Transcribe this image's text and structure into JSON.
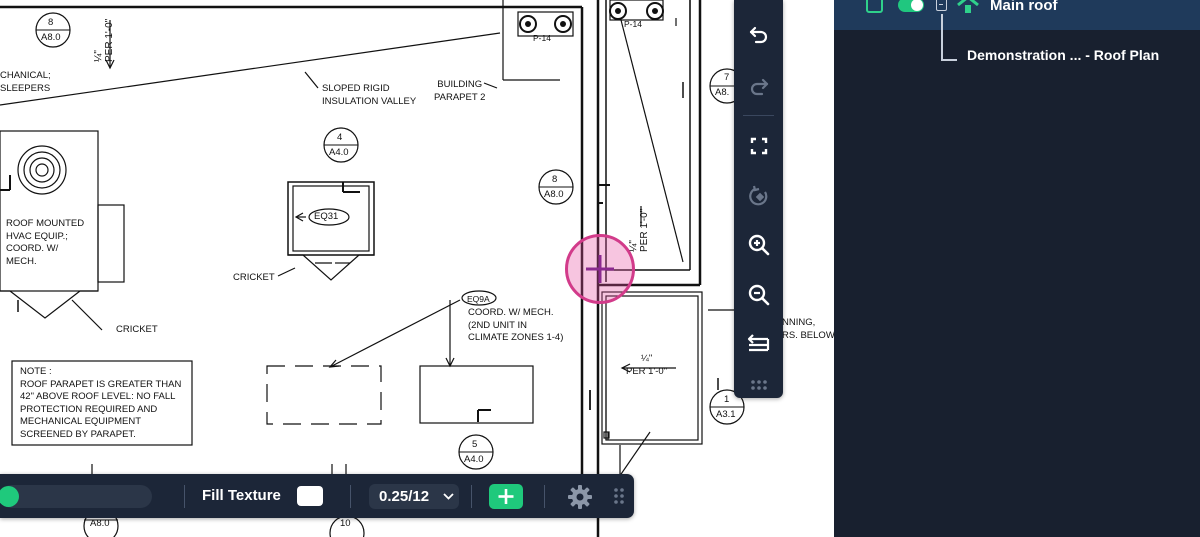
{
  "drawing": {
    "labels": {
      "mech": "CHANICAL;\nSLEEPERS",
      "sloped": "SLOPED RIGID\nINSULATION VALLEY",
      "parapet": "BUILDING\nPARAPET 2",
      "hvac": "ROOF MOUNTED\nHVAC EQUIP.;\nCOORD. W/\nMECH.",
      "cricket1": "CRICKET",
      "cricket2": "CRICKET",
      "eq31": "EQ31",
      "eq_tag_top": "EQ9A",
      "coord": "COORD. W/ MECH.\n(2ND UNIT IN\nCLIMATE ZONES 1-4)",
      "note": "NOTE :\nROOF PARAPET IS GREATER THAN\n42\" ABOVE ROOF LEVEL: NO FALL\nPROTECTION REQUIRED AND\nMECHANICAL EQUIPMENT\nSCREENED BY PARAPET.",
      "right_partial": "NNING,\nRS. BELOW",
      "p14a": "P-14",
      "p14b": "P-14",
      "slope_right": "¼\"\nPER 1'-0\"",
      "slope_left_v": "¼\"\nPER 1'-0\"",
      "slope_mid_v": "¼\"\nPER 1'-0\""
    },
    "callouts": [
      {
        "num": "8",
        "ref": "A8.0"
      },
      {
        "num": "4",
        "ref": "A4.0"
      },
      {
        "num": "8",
        "ref": "A8.0"
      },
      {
        "num": "7",
        "ref": "A8."
      },
      {
        "num": "5",
        "ref": "A4.0"
      },
      {
        "num": "1",
        "ref": "A3.1"
      },
      {
        "num": "",
        "ref": "A8.0"
      },
      {
        "num": "10",
        "ref": ""
      }
    ]
  },
  "vertical_toolbar": {
    "buttons": [
      "undo",
      "redo",
      "fit-screen",
      "rotate",
      "zoom-in",
      "zoom-out",
      "layers-toggle"
    ],
    "grip_icon": "grip-dots-icon"
  },
  "side_panel": {
    "layer_title": "Main roof",
    "child_item": "Demonstration ...  - Roof Plan",
    "accent": "#20c77f"
  },
  "bottom_toolbar": {
    "fill_label": "Fill Texture",
    "fill_color": "#ffffff",
    "pitch_value": "0.25/12",
    "add_icon": "plus-icon",
    "settings_icon": "gear-icon"
  }
}
